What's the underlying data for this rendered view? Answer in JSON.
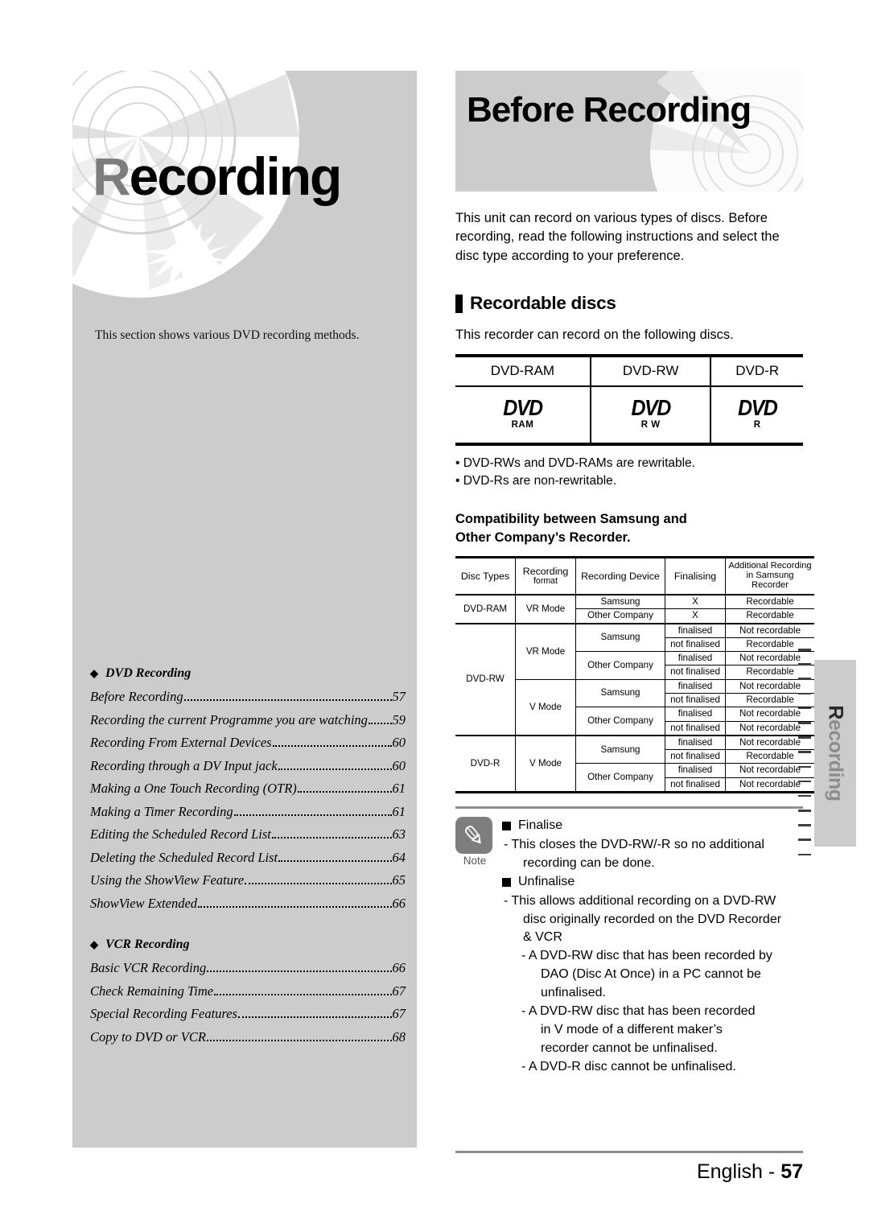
{
  "chapter": {
    "title_first": "R",
    "title_rest": "ecording",
    "description": "This section shows various DVD recording methods."
  },
  "toc": {
    "groups": [
      {
        "marker": "◆",
        "title": "DVD Recording",
        "entries": [
          {
            "title": "Before Recording",
            "page": "57"
          },
          {
            "title": "Recording the current Programme you are watching",
            "page": "59"
          },
          {
            "title": "Recording From External Devices",
            "page": "60"
          },
          {
            "title": "Recording through a DV Input jack",
            "page": "60"
          },
          {
            "title": "Making a One Touch Recording (OTR)",
            "page": "61"
          },
          {
            "title": "Making a Timer Recording",
            "page": "61"
          },
          {
            "title": "Editing the Scheduled Record List",
            "page": "63"
          },
          {
            "title": "Deleting the Scheduled Record List",
            "page": "64"
          },
          {
            "title": "Using the ShowView Feature",
            "page": "65"
          },
          {
            "title": "ShowView Extended",
            "page": "66"
          }
        ]
      },
      {
        "marker": "◆",
        "title": "VCR Recording",
        "entries": [
          {
            "title": "Basic VCR Recording",
            "page": "66"
          },
          {
            "title": "Check Remaining Time",
            "page": "67"
          },
          {
            "title": "Special Recording Features",
            "page": "67"
          },
          {
            "title": "Copy to DVD or VCR",
            "page": "68"
          }
        ]
      }
    ]
  },
  "banner": {
    "title": "Before Recording"
  },
  "intro": "This unit can record on various types of discs. Before recording, read the following instructions and select the disc type according to your preference.",
  "section": {
    "heading": "Recordable discs",
    "lead": "This recorder can record on the following discs."
  },
  "disc_table": {
    "headers": [
      "DVD-RAM",
      "DVD-RW",
      "DVD-R"
    ],
    "logos": [
      {
        "word": "DVD",
        "sub": "RAM"
      },
      {
        "word": "DVD",
        "sub": "R W"
      },
      {
        "word": "DVD",
        "sub": "R"
      }
    ]
  },
  "disc_bullets": [
    "• DVD-RWs and DVD-RAMs are rewritable.",
    "• DVD-Rs are non-rewritable."
  ],
  "compat": {
    "heading_line1": "Compatibility between Samsung and",
    "heading_line2": "Other Company’s Recorder.",
    "headers": [
      "Disc Types",
      "Recording format",
      "Recording Device",
      "Finalising",
      "Additional Recording in Samsung Recorder"
    ],
    "header_parts": [
      [
        "Disc Types"
      ],
      [
        "Recording",
        "format"
      ],
      [
        "Recording Device"
      ],
      [
        "Finalising"
      ],
      [
        "Additional Recording",
        "in Samsung Recorder"
      ]
    ],
    "rows": [
      {
        "disc": "DVD-RAM",
        "format": "VR Mode",
        "device": "Samsung",
        "final": "X",
        "result": "Recordable"
      },
      {
        "disc": "",
        "format": "",
        "device": "Other Company",
        "final": "X",
        "result": "Recordable"
      },
      {
        "disc": "DVD-RW",
        "format": "VR Mode",
        "device": "Samsung",
        "final": "finalised",
        "result": "Not recordable"
      },
      {
        "disc": "",
        "format": "",
        "device": "",
        "final": "not finalised",
        "result": "Recordable"
      },
      {
        "disc": "",
        "format": "",
        "device": "Other Company",
        "final": "finalised",
        "result": "Not recordable"
      },
      {
        "disc": "",
        "format": "",
        "device": "",
        "final": "not finalised",
        "result": "Recordable"
      },
      {
        "disc": "",
        "format": "V Mode",
        "device": "Samsung",
        "final": "finalised",
        "result": "Not recordable"
      },
      {
        "disc": "",
        "format": "",
        "device": "",
        "final": "not finalised",
        "result": "Recordable"
      },
      {
        "disc": "",
        "format": "",
        "device": "Other Company",
        "final": "finalised",
        "result": "Not recordable"
      },
      {
        "disc": "",
        "format": "",
        "device": "",
        "final": "not finalised",
        "result": "Not recordable"
      },
      {
        "disc": "DVD-R",
        "format": "V Mode",
        "device": "Samsung",
        "final": "finalised",
        "result": "Not recordable"
      },
      {
        "disc": "",
        "format": "",
        "device": "",
        "final": "not finalised",
        "result": "Recordable"
      },
      {
        "disc": "",
        "format": "",
        "device": "Other Company",
        "final": "finalised",
        "result": "Not recordable"
      },
      {
        "disc": "",
        "format": "",
        "device": "",
        "final": "not finalised",
        "result": "Not recordable"
      }
    ]
  },
  "note": {
    "label": "Note",
    "items": {
      "h1": "Finalise",
      "h1_l1": "- This closes the DVD-RW/-R so no additional",
      "h1_l2": "recording can be done.",
      "h2": "Unfinalise",
      "h2_l1": "- This allows additional recording on a DVD-RW",
      "h2_l2": "disc originally recorded on the DVD Recorder",
      "h2_l3": "& VCR",
      "s1_l1": "- A DVD-RW disc that has been recorded by",
      "s1_l2": "DAO (Disc At Once) in a PC cannot be",
      "s1_l3": "unfinalised.",
      "s2_l1": "- A DVD-RW disc that has been recorded",
      "s2_l2": "in V mode of a different maker’s",
      "s2_l3": "recorder cannot be unfinalised.",
      "s3_l1": "- A DVD-R disc cannot be unfinalised."
    }
  },
  "footer": {
    "language": "English - ",
    "page": "57"
  },
  "side_tab": {
    "first": "R",
    "rest": "ecording"
  }
}
